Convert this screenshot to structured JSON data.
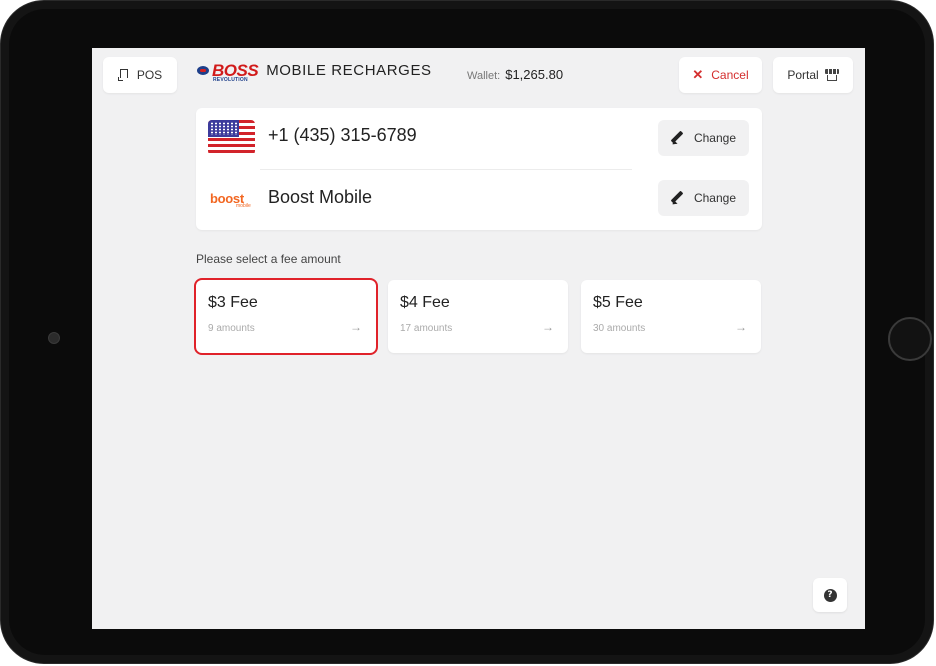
{
  "header": {
    "pos_label": "POS",
    "brand_name": "BOSS",
    "brand_sub": "REVOLUTION",
    "title": "MOBILE RECHARGES",
    "wallet_label": "Wallet:",
    "wallet_value": "$1,265.80",
    "cancel_label": "Cancel",
    "portal_label": "Portal"
  },
  "recipient": {
    "phone": "+1 (435) 315-6789",
    "carrier": "Boost Mobile",
    "carrier_logo_text": "boost",
    "carrier_logo_sub": "mobile",
    "change_label": "Change"
  },
  "fee_prompt": "Please select a fee amount",
  "fees": [
    {
      "title": "$3 Fee",
      "count": "9 amounts",
      "selected": true
    },
    {
      "title": "$4 Fee",
      "count": "17 amounts",
      "selected": false
    },
    {
      "title": "$5 Fee",
      "count": "30 amounts",
      "selected": false
    }
  ],
  "help_symbol": "?",
  "colors": {
    "accent_red": "#e0222a",
    "cancel_red": "#d42e2e",
    "brand_blue": "#1e3f8a",
    "boost_orange": "#f26722",
    "screen_bg": "#f1f1f2"
  },
  "icons": {
    "pos": "pos-icon",
    "brand": "boss-globe-icon",
    "cancel": "close-icon",
    "portal": "store-icon",
    "change": "pencil-icon",
    "fee_arrow": "arrow-right-icon",
    "help": "help-icon"
  }
}
